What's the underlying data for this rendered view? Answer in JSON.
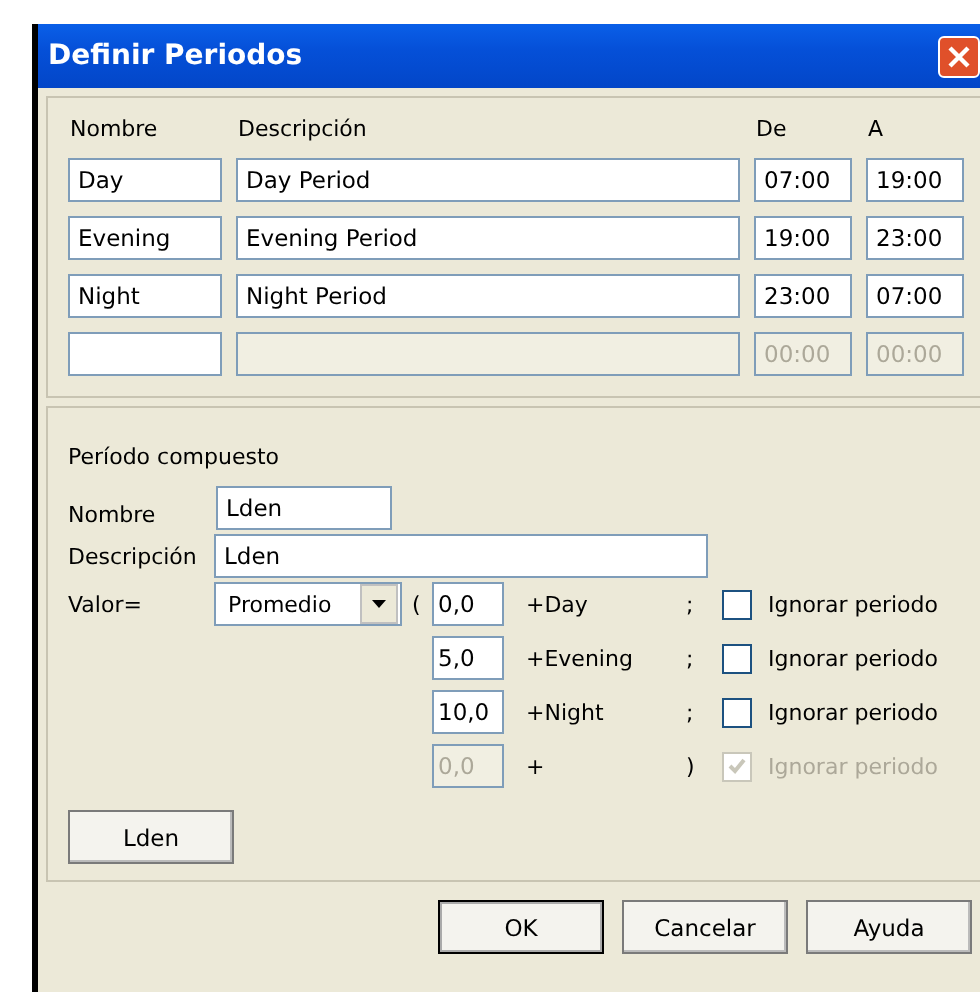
{
  "window": {
    "title": "Definir Periodos"
  },
  "periods": {
    "columns": [
      "Nombre",
      "Descripción",
      "De",
      "A"
    ],
    "rows": [
      {
        "name": "Day",
        "description": "Day Period",
        "from": "07:00",
        "to": "19:00",
        "disabled": false
      },
      {
        "name": "Evening",
        "description": "Evening Period",
        "from": "19:00",
        "to": "23:00",
        "disabled": false
      },
      {
        "name": "Night",
        "description": "Night Period",
        "from": "23:00",
        "to": "07:00",
        "disabled": false
      },
      {
        "from": "00:00",
        "to": "00:00",
        "disabled": true
      }
    ]
  },
  "composite": {
    "title": "Período compuesto",
    "name_label": "Nombre",
    "name": "Lden",
    "description_label": "Descripción",
    "description": "Lden",
    "value_label": "Valor=",
    "operation": "Promedio",
    "open_paren": "(",
    "terms": [
      {
        "weight": "0,0",
        "term": "+Day",
        "separator": ";",
        "ignore_label": "Ignorar periodo",
        "checked": false,
        "disabled": false
      },
      {
        "weight": "5,0",
        "term": "+Evening",
        "separator": ";",
        "ignore_label": "Ignorar periodo",
        "checked": false,
        "disabled": false
      },
      {
        "weight": "10,0",
        "term": "+Night",
        "separator": ";",
        "ignore_label": "Ignorar periodo",
        "checked": false,
        "disabled": false
      },
      {
        "weight": "0,0",
        "term": "+",
        "separator": ")",
        "ignore_label": "Ignorar periodo",
        "checked": true,
        "disabled": true
      }
    ],
    "button": "Lden"
  },
  "buttons": [
    {
      "label": "OK",
      "default": true
    },
    {
      "label": "Cancelar",
      "default": false
    },
    {
      "label": "Ayuda",
      "default": false
    }
  ]
}
